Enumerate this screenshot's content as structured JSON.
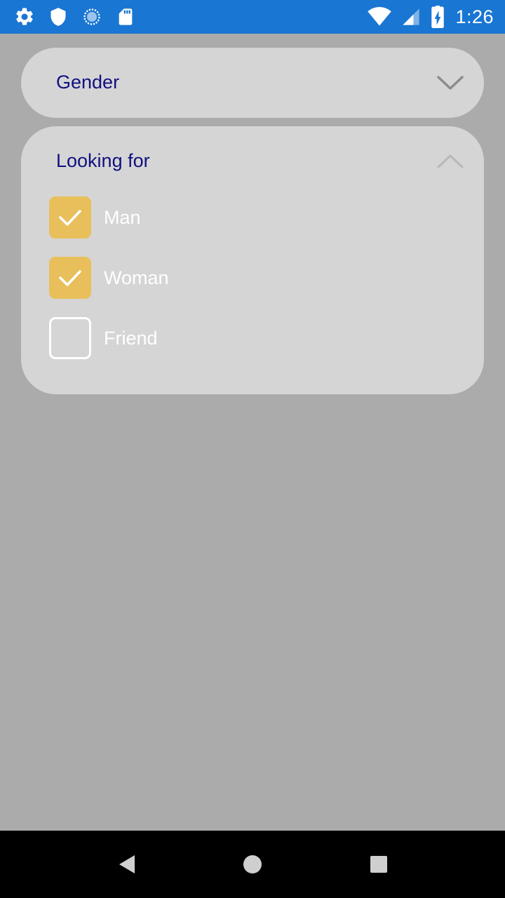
{
  "status_bar": {
    "time": "1:26",
    "left_icons": [
      "settings-icon",
      "shield-icon",
      "sync-icon",
      "sd-card-icon"
    ],
    "right_icons": [
      "wifi-icon",
      "signal-icon",
      "battery-charging-icon"
    ]
  },
  "filters": {
    "gender": {
      "title": "Gender",
      "expanded": false,
      "chevron": "chevron-down-icon"
    },
    "looking_for": {
      "title": "Looking for",
      "expanded": true,
      "chevron": "chevron-up-icon",
      "options": [
        {
          "label": "Man",
          "checked": true
        },
        {
          "label": "Woman",
          "checked": true
        },
        {
          "label": "Friend",
          "checked": false
        }
      ]
    }
  },
  "nav_bar": {
    "buttons": [
      "back-icon",
      "home-icon",
      "recents-icon"
    ]
  },
  "colors": {
    "status_bar": "#1976d2",
    "background": "#ababab",
    "card": "#d5d5d5",
    "title_text": "#101080",
    "checkbox_checked": "#e8bf5a",
    "option_text": "#ffffff"
  }
}
